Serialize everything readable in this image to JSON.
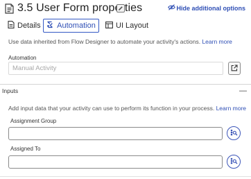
{
  "header": {
    "title": "3.5 User Form properties",
    "title_icon": "form-icon",
    "edit_icon": "pencil-icon",
    "hide_options_label": "Hide additional options",
    "hide_options_icon": "eye-slash-icon"
  },
  "tabs": [
    {
      "label": "Details",
      "icon": "document-icon",
      "active": false
    },
    {
      "label": "Automation",
      "icon": "automation-icon",
      "active": true
    },
    {
      "label": "UI Layout",
      "icon": "layout-icon",
      "active": false
    }
  ],
  "automation": {
    "description": "Use data inherited from Flow Designer to automate your activity's actions.",
    "learn_more": "Learn more",
    "field_label": "Automation",
    "field_placeholder": "Manual Activity",
    "open_icon": "open-external-icon"
  },
  "inputs": {
    "section_title": "Inputs",
    "collapse_symbol": "—",
    "description": "Add input data that your activity can use to perform its function in your process.",
    "learn_more": "Learn more",
    "fields": [
      {
        "label": "Assignment Group",
        "value": "",
        "picker_icon": "data-pill-picker-icon"
      },
      {
        "label": "Assigned To",
        "value": "",
        "picker_icon": "data-pill-picker-icon"
      }
    ]
  },
  "colors": {
    "accent": "#2f4fb5",
    "active_tab_border": "#3358c4",
    "text": "#2b2b2b",
    "muted": "#555555",
    "divider": "#d4d4d4"
  }
}
